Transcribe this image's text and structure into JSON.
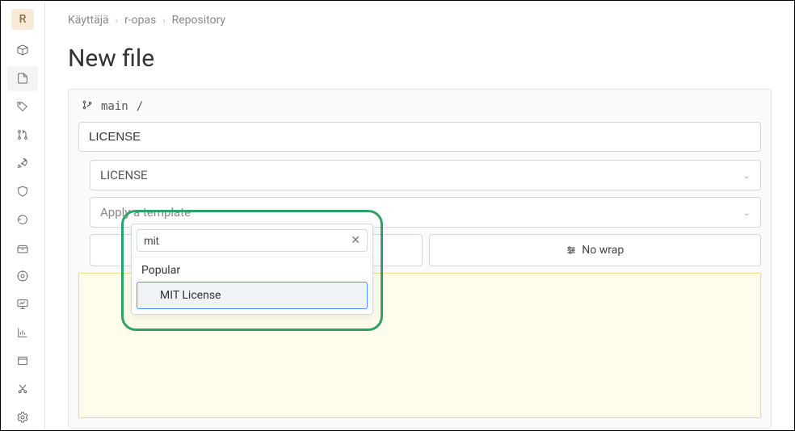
{
  "sidebar": {
    "avatar_letter": "R"
  },
  "breadcrumbs": {
    "user": "Käyttäjä",
    "project": "r-opas",
    "section": "Repository"
  },
  "page": {
    "title": "New file"
  },
  "branch": {
    "name": "main",
    "path_sep": "/"
  },
  "form": {
    "filename_value": "LICENSE",
    "template_select_value": "LICENSE",
    "apply_template_placeholder": "Apply a template",
    "nowrap_label": "No wrap"
  },
  "dropdown": {
    "search_value": "mit",
    "group_label": "Popular",
    "options": [
      {
        "label": "MIT License"
      }
    ]
  }
}
